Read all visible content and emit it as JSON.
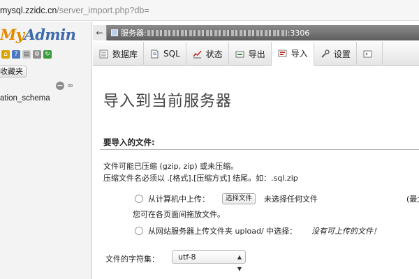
{
  "browser": {
    "url_host": "mysql.zzidc.cn",
    "url_path": "/server_import.php?db="
  },
  "sidebar": {
    "logo_part1": "My",
    "logo_part2": "Admin",
    "favorites_label": "收藏夹",
    "collapse_symbol": "−",
    "link_symbol": "∞",
    "db_item": "ation_schema"
  },
  "serverbar": {
    "back_symbol": "←",
    "prefix": "服务器:",
    "port_suffix": ":3306"
  },
  "tabs": [
    {
      "label": "数据库",
      "icon": "database-icon"
    },
    {
      "label": "SQL",
      "icon": "sql-icon"
    },
    {
      "label": "状态",
      "icon": "status-icon"
    },
    {
      "label": "导出",
      "icon": "export-icon"
    },
    {
      "label": "导入",
      "icon": "import-icon"
    },
    {
      "label": "设置",
      "icon": "settings-icon"
    },
    {
      "label": "",
      "icon": "more-icon"
    }
  ],
  "main": {
    "title": "导入到当前服务器",
    "section_label": "要导入的文件:",
    "note1": "文件可能已压缩 (gzip, zip) 或未压缩。",
    "note2": "压缩文件名必须以 .[格式].[压缩方式] 结尾。如：.sql.zip",
    "upload_option": "从计算机中上传：",
    "choose_file_button": "选择文件",
    "file_status": "未选择任何文件",
    "max_size": "(最大",
    "drag_hint": "您可在各页面间拖放文件。",
    "server_dir_option": "从网站服务器上传文件夹 upload/ 中选择：",
    "no_files": "没有可上传的文件！",
    "charset_label": "文件的字符集：",
    "charset_value": "utf-8"
  },
  "colors": {
    "logo_orange": "#e08a00",
    "logo_blue": "#3d6aa8",
    "serverbar": "#6e6e6e"
  }
}
